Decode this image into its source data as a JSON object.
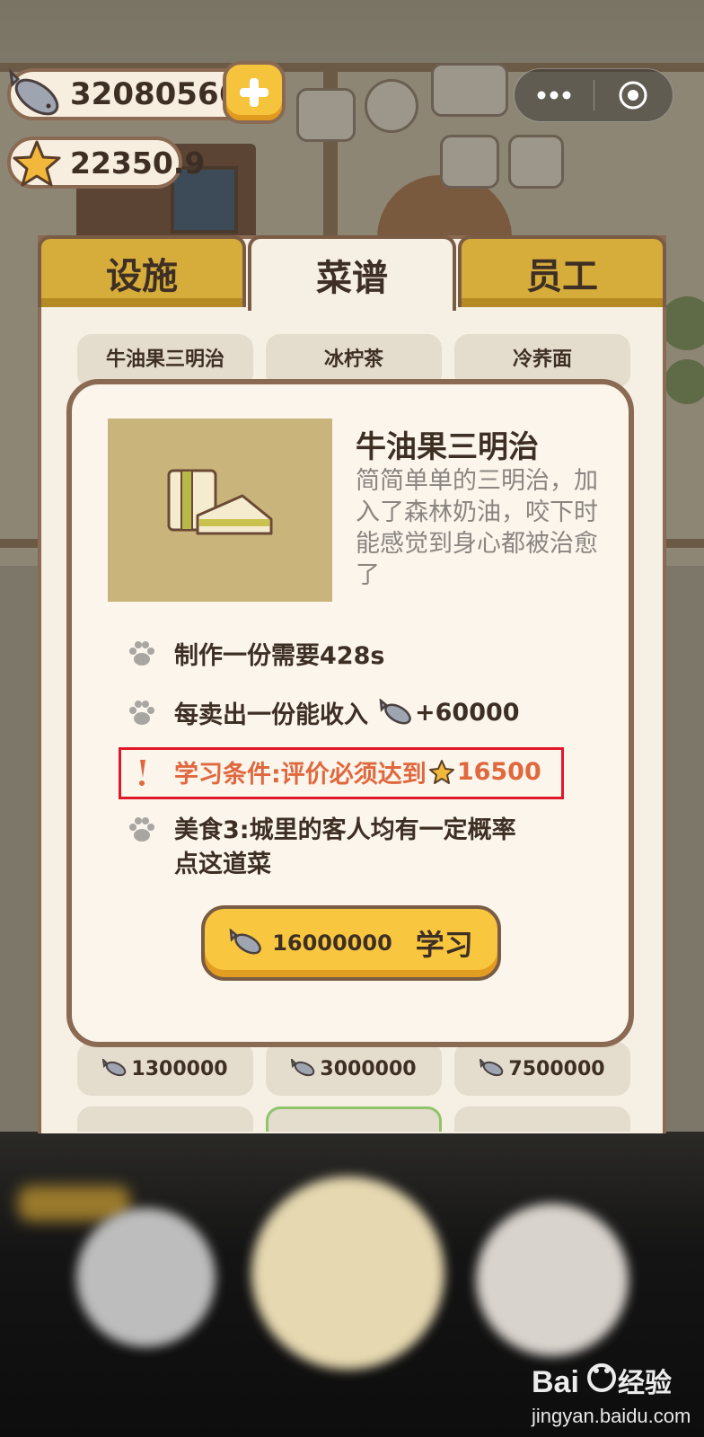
{
  "hud": {
    "fish_count": "32080566",
    "star_count": "22350.9"
  },
  "tabs": [
    {
      "label": "设施",
      "active": false
    },
    {
      "label": "菜谱",
      "active": true
    },
    {
      "label": "员工",
      "active": false
    }
  ],
  "recipe_cards_top": [
    "牛油果三明治",
    "冰柠茶",
    "冷荞面"
  ],
  "recipe_cards_bottom": [
    "1300000",
    "3000000",
    "7500000"
  ],
  "dialog": {
    "name": "牛油果三明治",
    "description": "简简单单的三明治，加入了森林奶油，咬下时能感觉到身心都被治愈了",
    "craft_time": "制作一份需要428s",
    "income_label": "每卖出一份能收入",
    "income_value": "+60000",
    "condition_label": "学习条件:评价必须达到",
    "condition_value": "16500",
    "perk_line1": "美食3:城里的客人均有一定概率",
    "perk_line2": "点这道菜",
    "learn_cost": "16000000",
    "learn_label": "学习"
  },
  "icons": {
    "fish": "fish-icon",
    "star": "star-icon",
    "paw": "paw-icon",
    "exclamation": "exclamation-icon"
  },
  "colors": {
    "accent_yellow": "#f8c63f",
    "warning_orange": "#e0683e",
    "highlight_red": "#e0192a",
    "text_dark": "#3e2f25",
    "desc_gray": "#8a8580"
  },
  "watermark": {
    "text": "jingyan.baidu.com"
  }
}
